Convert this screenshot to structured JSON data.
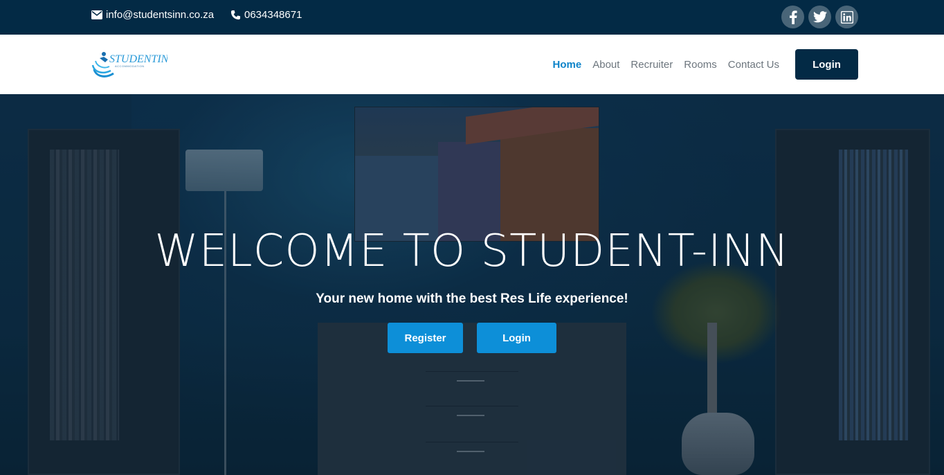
{
  "topbar": {
    "email": "info@studentsinn.co.za",
    "phone": "0634348671",
    "socials": [
      "facebook-icon",
      "twitter-icon",
      "linkedin-icon"
    ]
  },
  "navbar": {
    "logo_text": "STUDENTINN",
    "logo_tagline": "ACCOMMODATION",
    "links": [
      "Home",
      "About",
      "Recruiter",
      "Rooms",
      "Contact Us"
    ],
    "active": "Home",
    "login_label": "Login"
  },
  "hero": {
    "title": "WELCOME TO STUDENT-INN",
    "subtitle": "Your new home with the best Res Life experience!",
    "register_label": "Register",
    "login_label": "Login"
  },
  "colors": {
    "dark_navy": "#032a45",
    "accent_blue": "#0d8fd8",
    "active_link": "#0d83c9"
  }
}
